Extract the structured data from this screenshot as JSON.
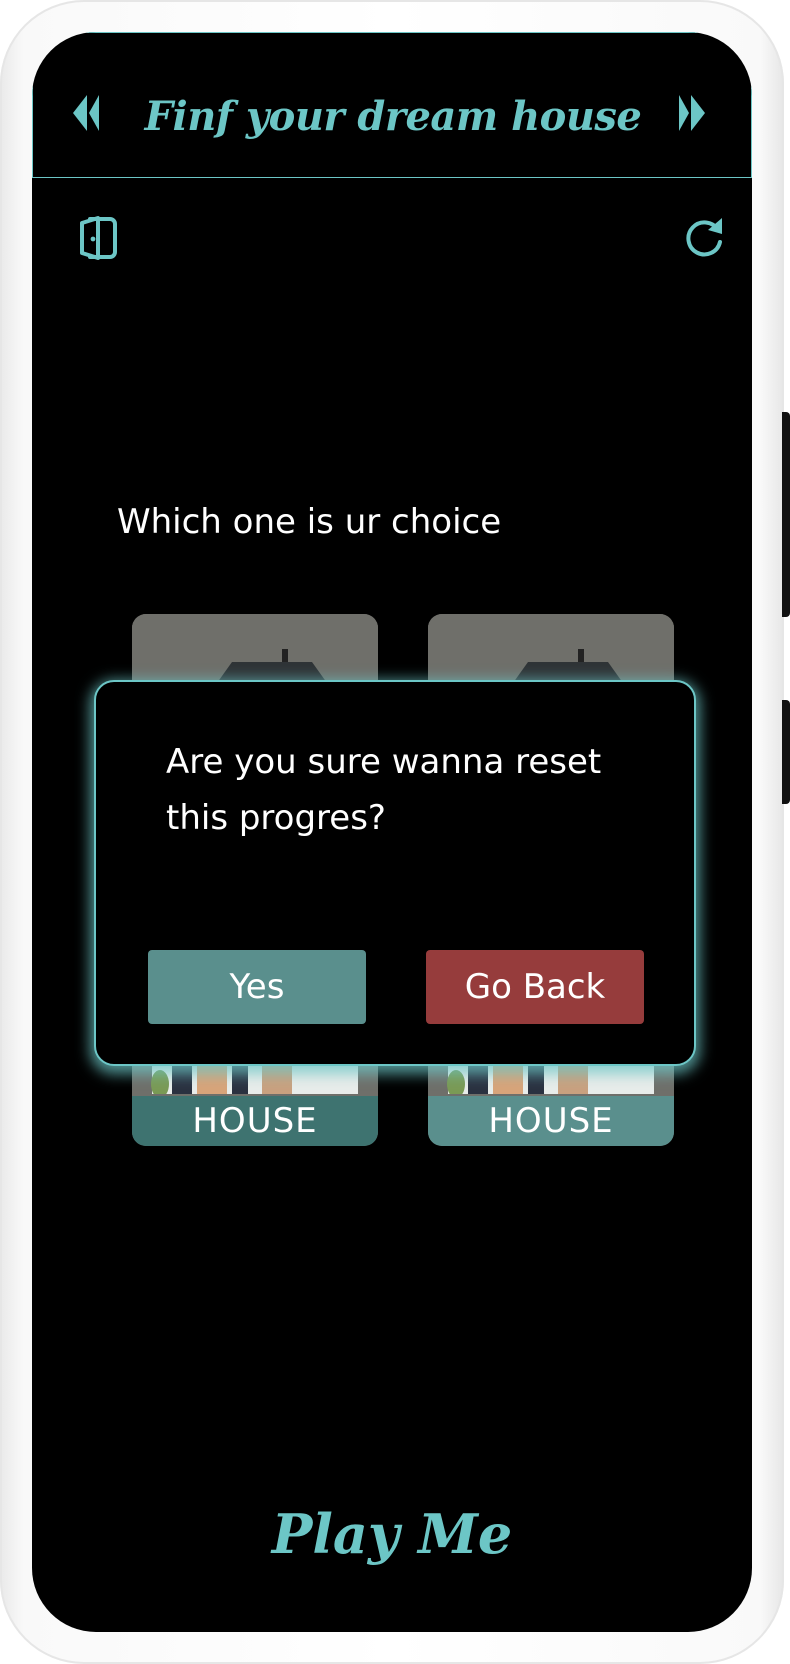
{
  "header": {
    "title": "Finf your dream house",
    "prev_icon": "double-chevron-left-icon",
    "next_icon": "double-chevron-right-icon"
  },
  "toolbar": {
    "exit_icon": "exit-door-icon",
    "reset_icon": "refresh-icon"
  },
  "question": "Which one is ur choice",
  "options": [
    {
      "label": "HOUSE"
    },
    {
      "label": "HOUSE"
    }
  ],
  "dialog": {
    "message": "Are you sure wanna reset this progres?",
    "confirm_label": "Yes",
    "cancel_label": "Go Back"
  },
  "footer": {
    "play_label": "Play Me"
  },
  "colors": {
    "accent": "#6cc6c6",
    "background": "#000000",
    "confirm": "#5a8f8d",
    "cancel": "#963c3c"
  }
}
